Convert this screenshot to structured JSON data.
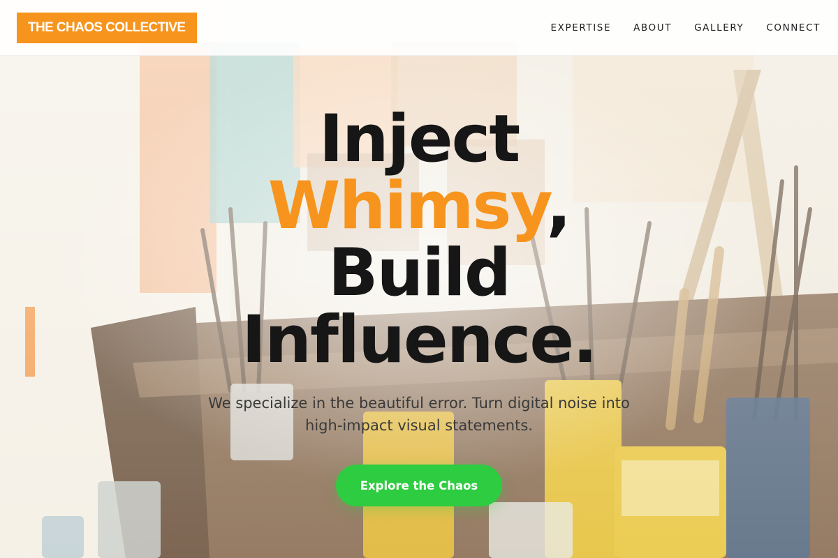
{
  "brand": {
    "name": "THE CHAOS COLLECTIVE",
    "accent_color": "#f7941d",
    "cta_color": "#2ecc40"
  },
  "nav": {
    "items": [
      {
        "label": "EXPERTISE"
      },
      {
        "label": "ABOUT"
      },
      {
        "label": "GALLERY"
      },
      {
        "label": "CONNECT"
      }
    ]
  },
  "hero": {
    "headline": {
      "line1": "Inject",
      "line2_accent": "Whimsy",
      "line2_punct": ",",
      "line3": "Build",
      "line4": "Influence."
    },
    "subtitle_line1": "We specialize in the beautiful error. Turn digital noise into",
    "subtitle_line2": "high-impact visual statements.",
    "cta_label": "Explore the Chaos",
    "background_image": "artist-studio-paint-brushes-photo"
  }
}
